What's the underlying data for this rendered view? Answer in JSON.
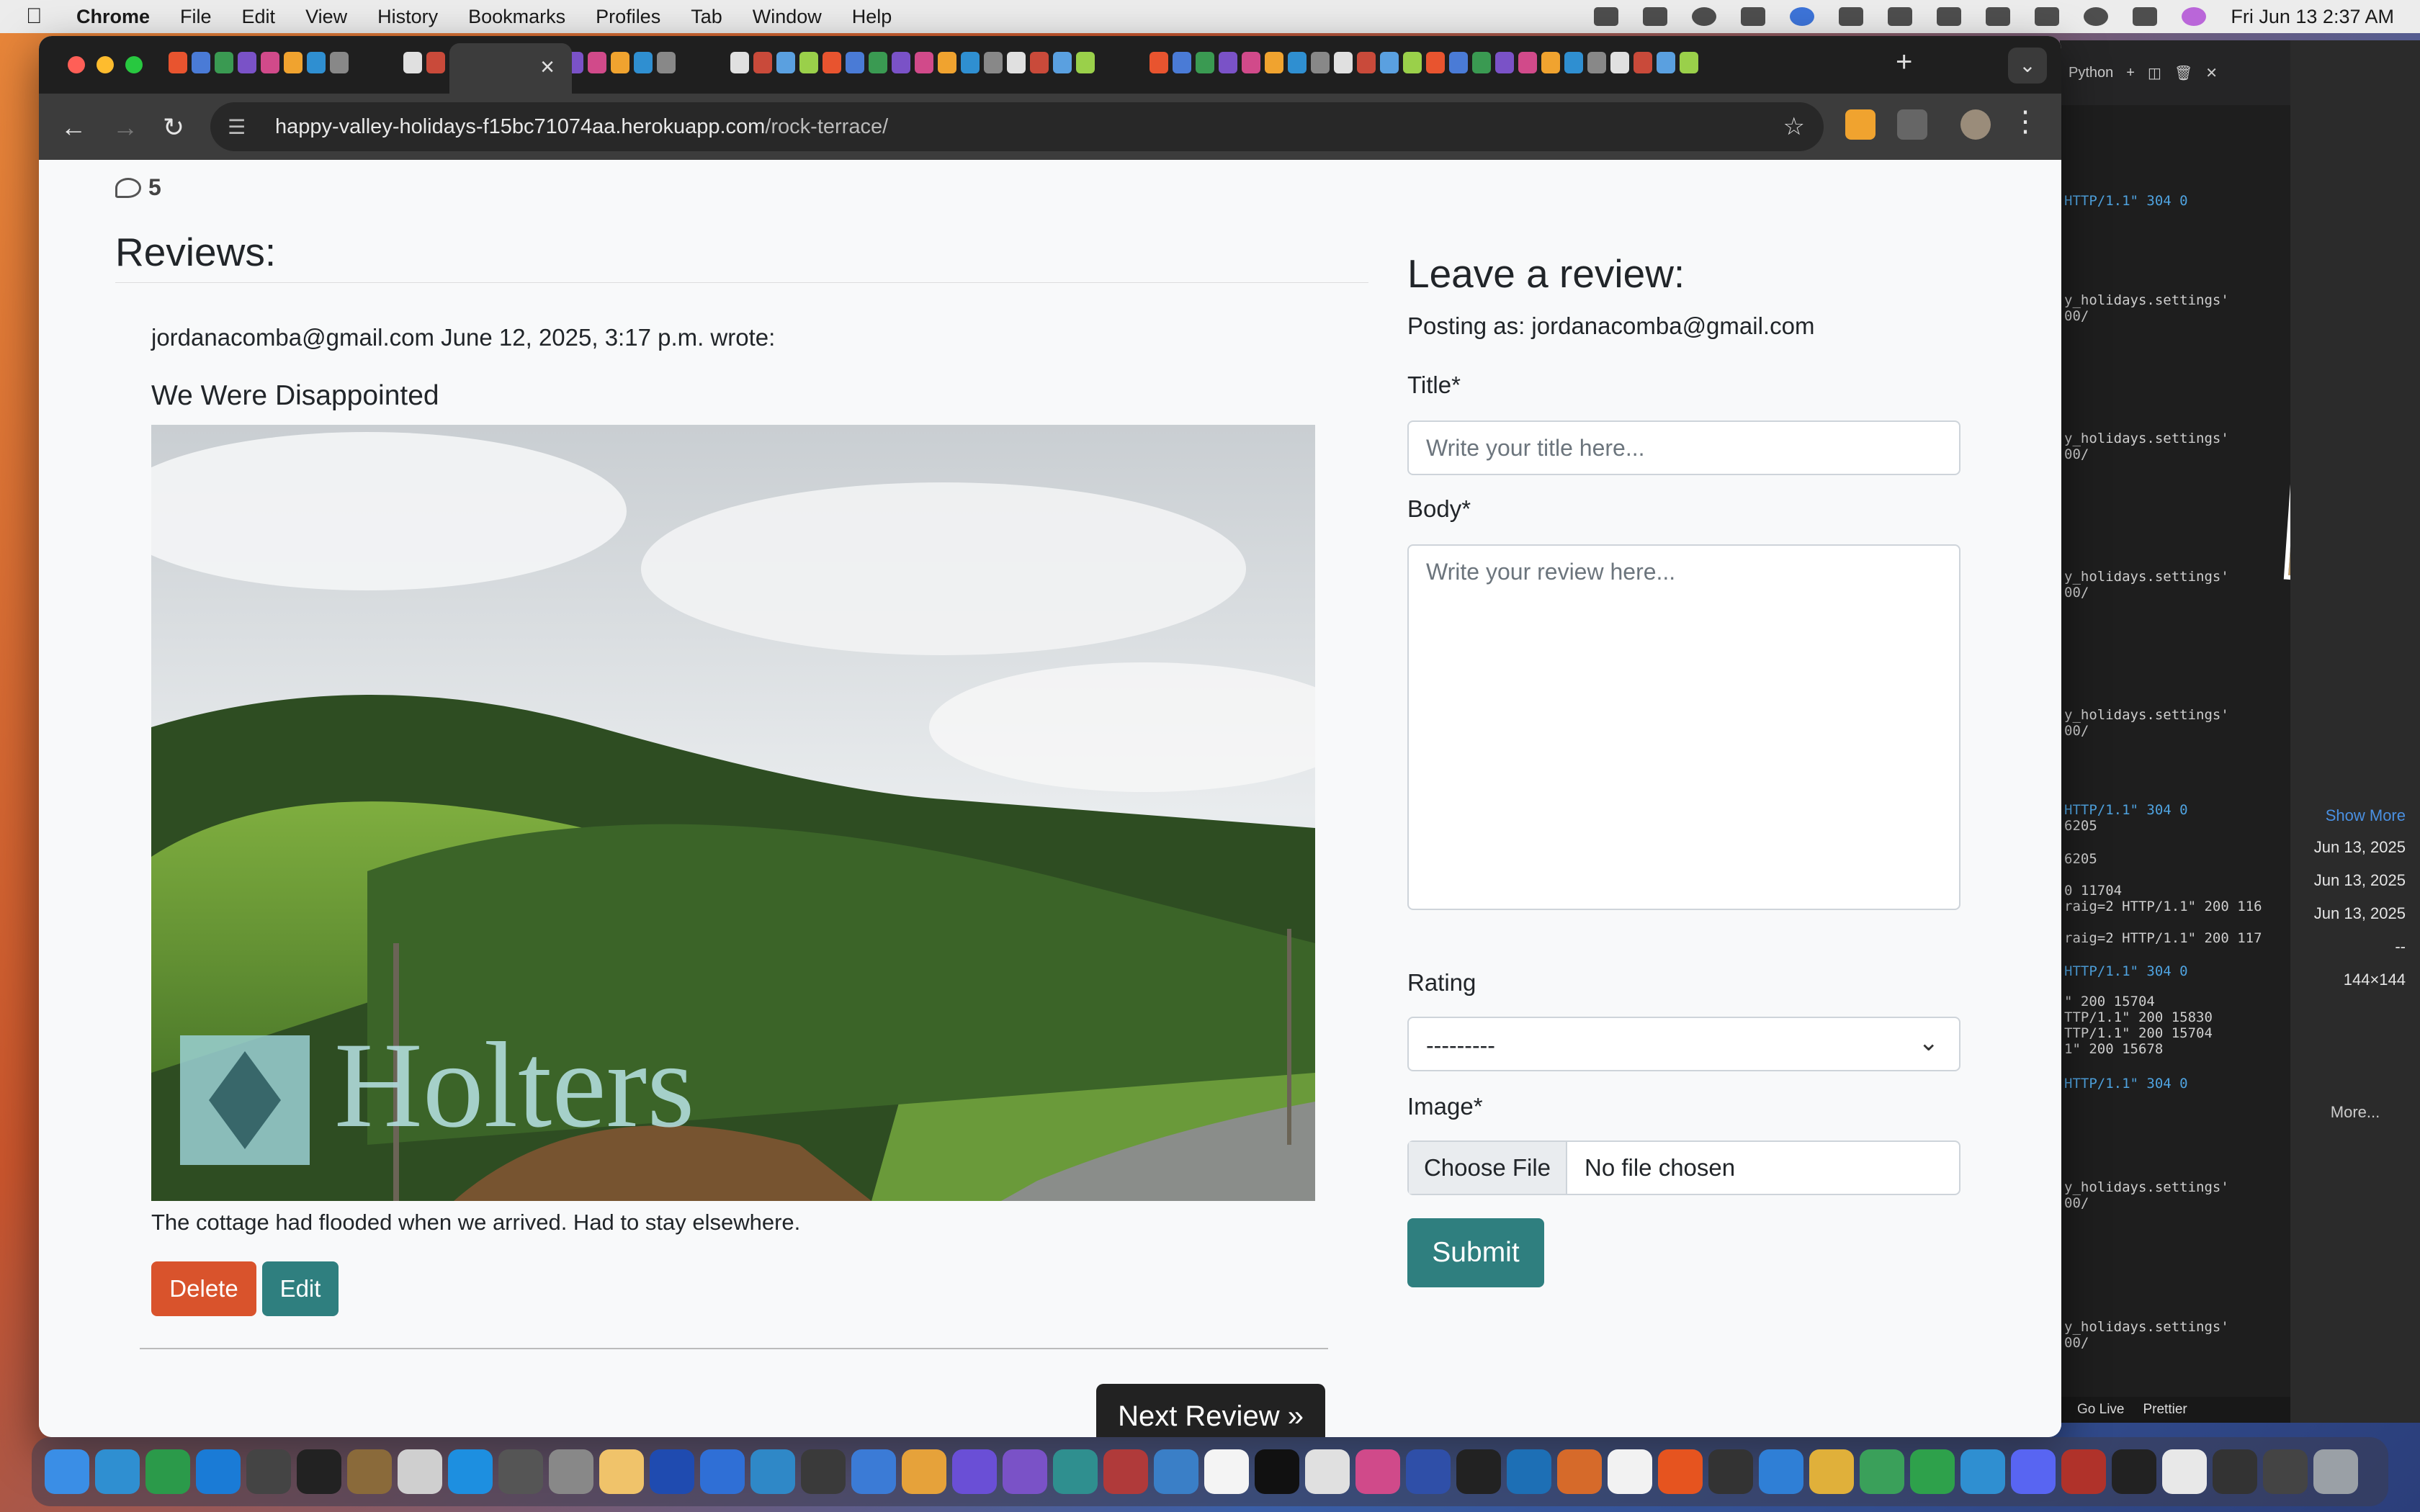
{
  "menubar": {
    "app": "Chrome",
    "items": [
      "File",
      "Edit",
      "View",
      "History",
      "Bookmarks",
      "Profiles",
      "Tab",
      "Window",
      "Help"
    ],
    "clock": "Fri Jun 13  2:37 AM"
  },
  "browser": {
    "url_host": "happy-valley-holidays-f15bc71074aa.herokuapp.com",
    "url_path": "/rock-terrace/"
  },
  "page": {
    "comment_count": "5",
    "reviews_heading": "Reviews:",
    "review": {
      "meta": "jordanacomba@gmail.com June 12, 2025, 3:17 p.m. wrote:",
      "title": "We Were Disappointed",
      "watermark": "Holters",
      "body": "The cottage had flooded when we arrived. Had to stay elsewhere.",
      "delete_label": "Delete",
      "edit_label": "Edit"
    },
    "next_review_label": "Next Review »",
    "form": {
      "heading": "Leave a review:",
      "posting_as": "Posting as: jordanacomba@gmail.com",
      "title_label": "Title*",
      "title_placeholder": "Write your title here...",
      "body_label": "Body*",
      "body_placeholder": "Write your review here...",
      "rating_label": "Rating",
      "rating_value": "---------",
      "image_label": "Image*",
      "choose_file": "Choose File",
      "no_file": "No file chosen",
      "submit_label": "Submit"
    }
  },
  "terminal": {
    "lines": [
      "HTTP/1.1\" 304 0",
      "y_holidays.settings'",
      "00/",
      "y_holidays.settings'",
      "00/",
      "y_holidays.settings'",
      "00/",
      "y_holidays.settings'",
      "00/",
      "HTTP/1.1\" 304 0",
      "6205",
      "6205",
      "0 11704",
      "raig=2 HTTP/1.1\" 200 116",
      "raig=2 HTTP/1.1\" 200 117",
      "HTTP/1.1\" 304 0",
      "\" 200 15704",
      "TTP/1.1\" 200 15830",
      "TTP/1.1\" 200 15704",
      "1\" 200 15678",
      "HTTP/1.1\" 304 0",
      "y_holidays.settings'",
      "00/",
      "y_holidays.settings'",
      "00/"
    ],
    "top_label": "Python",
    "status_golive": "Go Live",
    "status_prettier": "Prettier"
  },
  "sidepanel": {
    "show_more": "Show More",
    "dates": [
      "Jun 13, 2025",
      "Jun 13, 2025",
      "Jun 13, 2025"
    ],
    "dash": "--",
    "size": "144×144",
    "more": "More..."
  },
  "colors": {
    "delete": "#d9532c",
    "teal": "#2f7f7f",
    "next": "#222222"
  }
}
